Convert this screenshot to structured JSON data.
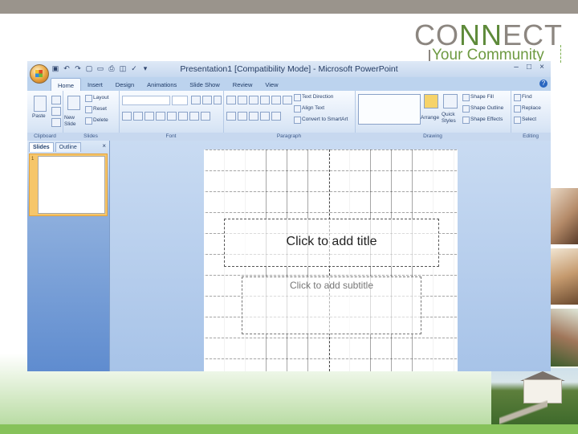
{
  "template": {
    "logo_connect_a": "CO",
    "logo_connect_b": "NN",
    "logo_connect_c": "ECT",
    "logo_tagline": "Your Community"
  },
  "window": {
    "title": "Presentation1 [Compatibility Mode] - Microsoft PowerPoint",
    "tabs": [
      "Home",
      "Insert",
      "Design",
      "Animations",
      "Slide Show",
      "Review",
      "View"
    ]
  },
  "ribbon": {
    "clipboard": {
      "label": "Clipboard",
      "paste": "Paste"
    },
    "slides": {
      "label": "Slides",
      "new_slide": "New Slide",
      "layout": "Layout",
      "reset": "Reset",
      "delete": "Delete"
    },
    "font": {
      "label": "Font"
    },
    "paragraph": {
      "label": "Paragraph",
      "text_direction": "Text Direction",
      "align_text": "Align Text",
      "convert": "Convert to SmartArt"
    },
    "drawing": {
      "label": "Drawing",
      "arrange": "Arrange",
      "quick_styles": "Quick Styles",
      "shape_fill": "Shape Fill",
      "shape_outline": "Shape Outline",
      "shape_effects": "Shape Effects"
    },
    "editing": {
      "label": "Editing",
      "find": "Find",
      "replace": "Replace",
      "select": "Select"
    }
  },
  "panes": {
    "slides_tab": "Slides",
    "outline_tab": "Outline",
    "thumb_number": "1"
  },
  "slide": {
    "title_placeholder": "Click to add title",
    "subtitle_placeholder": "Click to add subtitle"
  }
}
